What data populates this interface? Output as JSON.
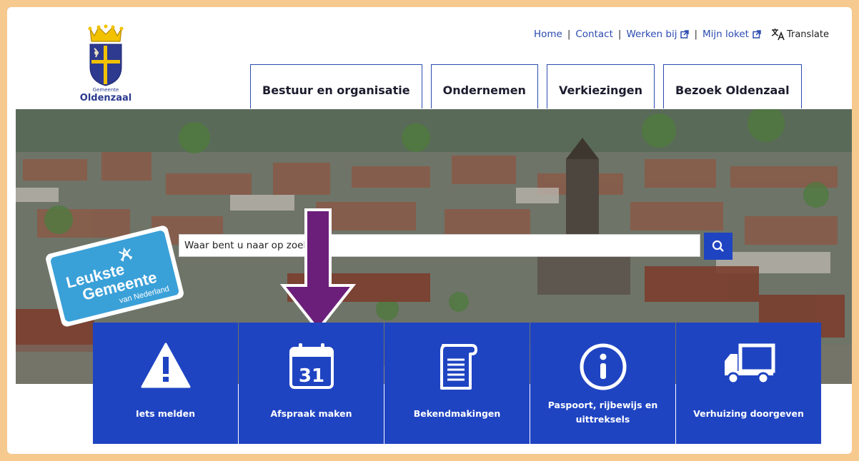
{
  "logo": {
    "small": "Gemeente",
    "name": "Oldenzaal"
  },
  "toplinks": {
    "home": "Home",
    "contact": "Contact",
    "werken": "Werken bij",
    "loket": "Mijn loket",
    "translate": "Translate",
    "separator": "|"
  },
  "mainnav": [
    {
      "label": "Bestuur en organisatie"
    },
    {
      "label": "Ondernemen"
    },
    {
      "label": "Verkiezingen"
    },
    {
      "label": "Bezoek Oldenzaal"
    }
  ],
  "search": {
    "placeholder": "Waar bent u naar op zoek?"
  },
  "badge": {
    "line1": "Leukste",
    "line2": "Gemeente",
    "line3": "van Nederland"
  },
  "tiles": [
    {
      "label": "Iets melden",
      "icon": "warning-icon"
    },
    {
      "label": "Afspraak maken",
      "icon": "calendar-icon",
      "day": "31"
    },
    {
      "label": "Bekendmakingen",
      "icon": "document-icon"
    },
    {
      "label": "Paspoort, rijbewijs en uittreksels",
      "icon": "info-icon"
    },
    {
      "label": "Verhuizing doorgeven",
      "icon": "truck-icon"
    }
  ],
  "colors": {
    "brand": "#1f44c2",
    "link": "#2b4bb0",
    "frame": "#f6c98f",
    "arrow": "#6b1f7a",
    "badge": "#3aa0d8"
  }
}
